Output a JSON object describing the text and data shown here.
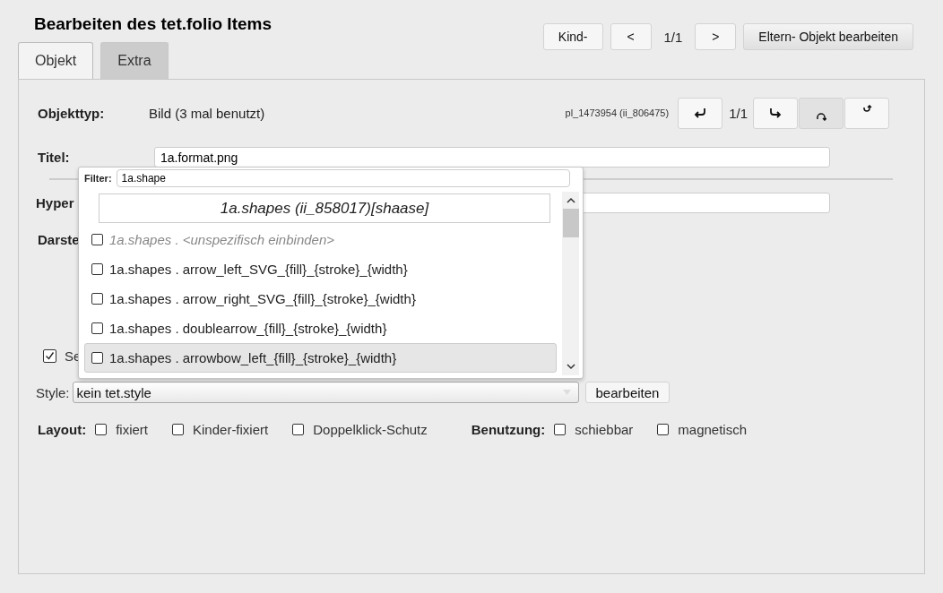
{
  "window": {
    "title": "Bearbeiten des tet.folio Items"
  },
  "nav": {
    "child_button": "Kind-",
    "prev_button": "<",
    "position": "1/1",
    "next_button": ">",
    "parent_button": "Eltern- Objekt bearbeiten"
  },
  "tabs": [
    {
      "label": "Objekt",
      "selected": true
    },
    {
      "label": "Extra",
      "selected": false
    }
  ],
  "object_type": {
    "label": "Objekttyp:",
    "value": "Bild (3 mal benutzt)",
    "id": "pl_1473954 (ii_806475)",
    "position": "1/1"
  },
  "history_buttons": [
    {
      "kind": "undo",
      "pressed": false
    },
    {
      "kind": "redo",
      "pressed": false
    },
    {
      "kind": "arc-down",
      "pressed": true
    },
    {
      "kind": "arc-up",
      "pressed": false
    }
  ],
  "title_field": {
    "label": "Titel:",
    "value": "1a.format.png"
  },
  "hyperlink": {
    "label": "Hyper"
  },
  "display": {
    "label": "Darste"
  },
  "option": {
    "label": "Se",
    "checked": true
  },
  "style": {
    "label": "Style:",
    "value": "kein tet.style",
    "button": "bearbeiten"
  },
  "layout": {
    "label": "Layout:",
    "options": [
      {
        "label": "fixiert",
        "checked": false
      },
      {
        "label": "Kinder-fixiert",
        "checked": false
      },
      {
        "label": "Doppelklick-Schutz",
        "checked": false
      }
    ]
  },
  "usage": {
    "label": "Benutzung:",
    "options": [
      {
        "label": "schiebbar",
        "checked": false
      },
      {
        "label": "magnetisch",
        "checked": false
      }
    ]
  },
  "dropdown": {
    "filter_label": "Filter:",
    "filter_value": "1a.shape",
    "header": "1a.shapes (ii_858017)[shaase]",
    "items": [
      {
        "kind": "unspecific",
        "text": "1a.shapes . <unspezifisch einbinden>",
        "checked": false,
        "highlighted": false
      },
      {
        "kind": "entry",
        "text": "1a.shapes . arrow_left_SVG_{fill}_{stroke}_{width}",
        "checked": false,
        "highlighted": false
      },
      {
        "kind": "entry",
        "text": "1a.shapes . arrow_right_SVG_{fill}_{stroke}_{width}",
        "checked": false,
        "highlighted": false
      },
      {
        "kind": "entry",
        "text": "1a.shapes . doublearrow_{fill}_{stroke}_{width}",
        "checked": false,
        "highlighted": false
      },
      {
        "kind": "entry",
        "text": "1a.shapes . arrowbow_left_{fill}_{stroke}_{width}",
        "checked": false,
        "highlighted": true
      }
    ]
  }
}
